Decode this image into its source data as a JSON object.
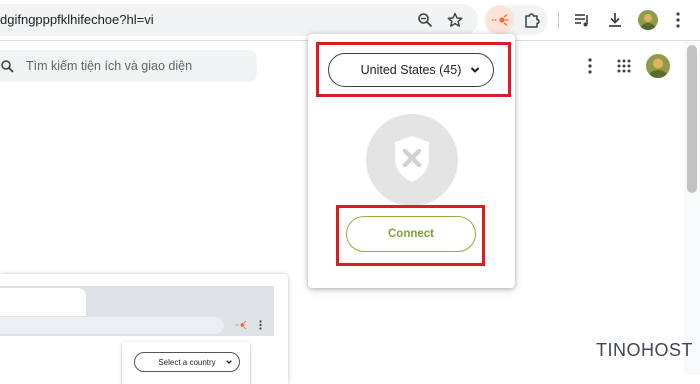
{
  "browser": {
    "url": "dgifngpppfklhifechoe?hl=vi",
    "icons": [
      "zoom-icon",
      "star-icon",
      "extension-active-icon",
      "puzzle-icon",
      "reading-list-icon",
      "download-icon",
      "profile-avatar"
    ]
  },
  "page": {
    "search_placeholder": "Tìm kiếm tiện ích và giao diện"
  },
  "popup": {
    "country_selected": "United States (45)",
    "connect_label": "Connect",
    "status_icon": "shield-disconnected-icon"
  },
  "preview": {
    "select_label": "Select a country"
  },
  "watermark": {
    "text": "TINOHOST"
  },
  "colors": {
    "highlight": "#d81d24",
    "connect": "#8ab43c",
    "extension_accent": "#f26b3a"
  }
}
